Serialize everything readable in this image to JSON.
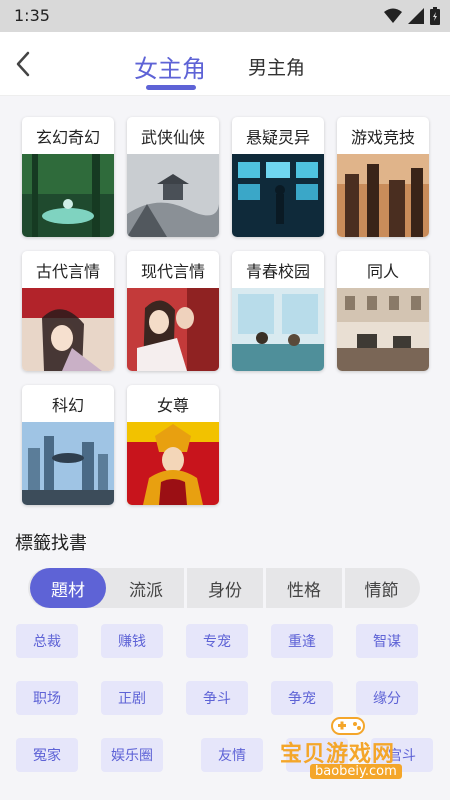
{
  "status_bar": {
    "time": "1:35"
  },
  "header": {
    "tabs": [
      {
        "label": "女主角",
        "active": true
      },
      {
        "label": "男主角",
        "active": false
      }
    ],
    "accent": "#5e63d6"
  },
  "genres": [
    {
      "label": "玄幻奇幻"
    },
    {
      "label": "武侠仙侠"
    },
    {
      "label": "悬疑灵异"
    },
    {
      "label": "游戏竞技"
    },
    {
      "label": "古代言情"
    },
    {
      "label": "现代言情"
    },
    {
      "label": "青春校园"
    },
    {
      "label": "同人"
    },
    {
      "label": "科幻"
    },
    {
      "label": "女尊"
    }
  ],
  "tag_section": {
    "title": "標籤找書",
    "filter_tabs": [
      "題材",
      "流派",
      "身份",
      "性格",
      "情節"
    ],
    "active_tab": "題材",
    "tags": [
      "总裁",
      "赚钱",
      "专宠",
      "重逢",
      "智谋",
      "职场",
      "正剧",
      "争斗",
      "争宠",
      "缘分",
      "冤家",
      "娱乐圈",
      "友情",
      "",
      "宫斗"
    ]
  },
  "watermark": {
    "text": "宝贝游戏网",
    "url": "baobeiy.com"
  }
}
